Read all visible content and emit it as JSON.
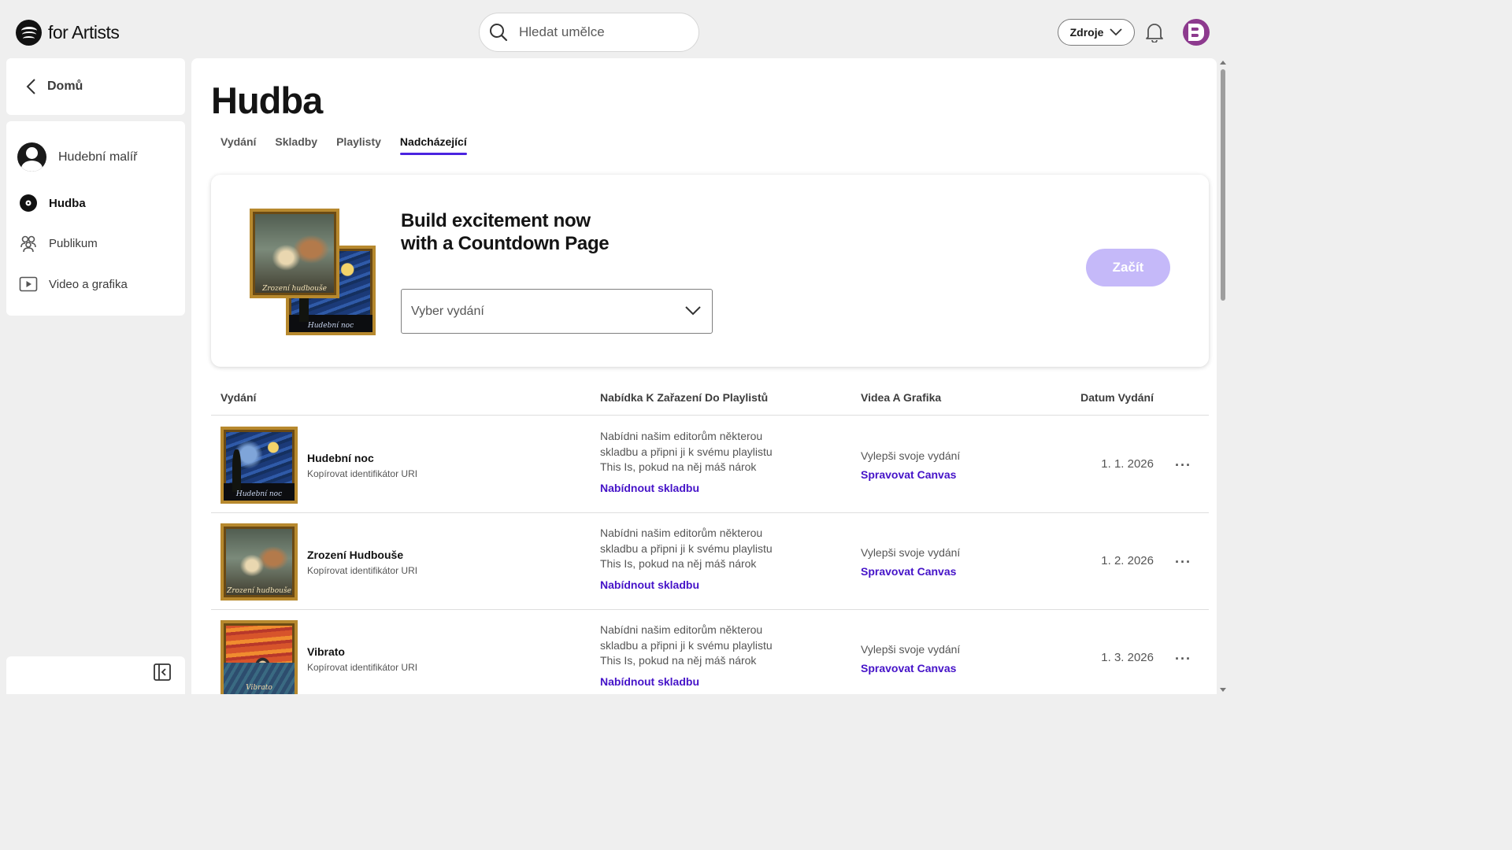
{
  "header": {
    "brand": "for Artists",
    "search_placeholder": "Hledat umělce",
    "resources_label": "Zdroje"
  },
  "sidebar": {
    "home_label": "Domů",
    "artist_name": "Hudební malíř",
    "items": [
      {
        "label": "Hudba",
        "icon": "vinyl-icon",
        "active": true
      },
      {
        "label": "Publikum",
        "icon": "audience-icon",
        "active": false
      },
      {
        "label": "Video a grafika",
        "icon": "video-icon",
        "active": false
      }
    ]
  },
  "page": {
    "title": "Hudba",
    "tabs": [
      {
        "label": "Vydání",
        "active": false
      },
      {
        "label": "Skladby",
        "active": false
      },
      {
        "label": "Playlisty",
        "active": false
      },
      {
        "label": "Nadcházející",
        "active": true
      }
    ]
  },
  "promo": {
    "title_line1": "Build excitement now",
    "title_line2": "with a Countdown Page",
    "select_placeholder": "Vyber vydání",
    "start_label": "Začít",
    "art_front_caption": "Zrození hudbouše",
    "art_back_caption": "Hudební noc"
  },
  "table": {
    "headers": {
      "release": "Vydání",
      "pitch": "Nabídka K Zařazení Do Playlistů",
      "canvas": "Videa A Grafika",
      "date": "Datum Vydání"
    },
    "rows": [
      {
        "title": "Hudební noc",
        "uri_label": "Kopírovat identifikátor URI",
        "pitch_text": "Nabídni našim editorům některou skladbu a připni ji k svému playlistu This Is, pokud na něj máš nárok",
        "pitch_link": "Nabídnout skladbu",
        "canvas_text": "Vylepši svoje vydání",
        "canvas_link": "Spravovat Canvas",
        "date": "1. 1. 2026",
        "art_caption": "Hudební noc",
        "more": "···"
      },
      {
        "title": "Zrození Hudbouše",
        "uri_label": "Kopírovat identifikátor URI",
        "pitch_text": "Nabídni našim editorům některou skladbu a připni ji k svému playlistu This Is, pokud na něj máš nárok",
        "pitch_link": "Nabídnout skladbu",
        "canvas_text": "Vylepši svoje vydání",
        "canvas_link": "Spravovat Canvas",
        "date": "1. 2. 2026",
        "art_caption": "Zrození hudbouše",
        "more": "···"
      },
      {
        "title": "Vibrato",
        "uri_label": "Kopírovat identifikátor URI",
        "pitch_text": "Nabídni našim editorům některou skladbu a připni ji k svému playlistu This Is, pokud na něj máš nárok",
        "pitch_link": "Nabídnout skladbu",
        "canvas_text": "Vylepši svoje vydání",
        "canvas_link": "Spravovat Canvas",
        "date": "1. 3. 2026",
        "art_caption": "Vibrato",
        "more": "···"
      }
    ]
  },
  "colors": {
    "accent": "#4a23e0",
    "link": "#4513c8",
    "start_button": "#c5b9f9",
    "avatar": "#8d3a8e"
  }
}
